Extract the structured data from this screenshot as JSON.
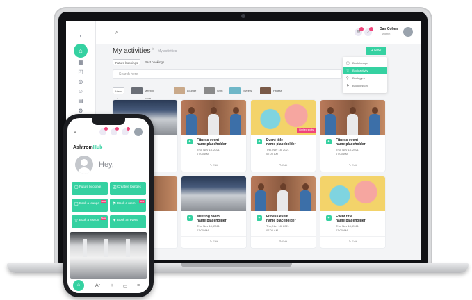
{
  "colors": {
    "accent": "#35d1a1",
    "badge": "#f0447a"
  },
  "topbar": {
    "user_name": "Dan Cohen",
    "user_role": "Admin",
    "icons": [
      "search-icon",
      "notification-icon",
      "avatar"
    ]
  },
  "header": {
    "title": "My activities",
    "breadcrumb": "My activities",
    "new_button": "+ New"
  },
  "tabs": [
    "Future bookings",
    "Past bookings"
  ],
  "search": {
    "placeholder": "Search here"
  },
  "dropdown": {
    "items": [
      "Book lounge",
      "Book activity",
      "Book gym",
      "Book lesson"
    ]
  },
  "filters": {
    "all": "View all",
    "items": [
      "Meeting room",
      "Lounge",
      "Gym",
      "Sweets",
      "Fitness"
    ]
  },
  "cards": [
    {
      "t1": "Fitness event",
      "t2": "name placeholder",
      "d1": "Thu, Nov 18, 2021",
      "d2": "07:00 AM",
      "edit": "✎ Edit",
      "ribbon": ""
    },
    {
      "t1": "Event title",
      "t2": "name placeholder",
      "d1": "Thu, Nov 18, 2021",
      "d2": "07:00 AM",
      "edit": "✎ Edit",
      "ribbon": "Limited spots"
    },
    {
      "t1": "Fitness event",
      "t2": "name placeholder",
      "d1": "Thu, Nov 18, 2021",
      "d2": "07:00 AM",
      "edit": "✎ Edit",
      "ribbon": ""
    },
    {
      "t1": "Meeting room",
      "t2": "name placeholder",
      "d1": "Thu, Nov 18, 2021",
      "d2": "07:00 AM",
      "edit": "✎ Edit",
      "ribbon": ""
    },
    {
      "t1": "Fitness event",
      "t2": "name placeholder",
      "d1": "Thu, Nov 18, 2021",
      "d2": "07:00 AM",
      "edit": "✎ Edit",
      "ribbon": ""
    },
    {
      "t1": "Event title",
      "t2": "name placeholder",
      "d1": "Thu, Nov 18, 2021",
      "d2": "07:00 AM",
      "edit": "✎ Edit",
      "ribbon": ""
    }
  ],
  "phone": {
    "brand": "Ashtrom",
    "brand_suffix": "Hub",
    "greeting": "Hey,",
    "buttons": [
      {
        "label": "Future bookings",
        "badge": ""
      },
      {
        "label": "Creative lounges",
        "badge": ""
      },
      {
        "label": "Book a lounge",
        "badge": "New"
      },
      {
        "label": "Book a room",
        "badge": "New"
      },
      {
        "label": "Book a lesson",
        "badge": "New"
      },
      {
        "label": "Book an event",
        "badge": ""
      }
    ]
  }
}
